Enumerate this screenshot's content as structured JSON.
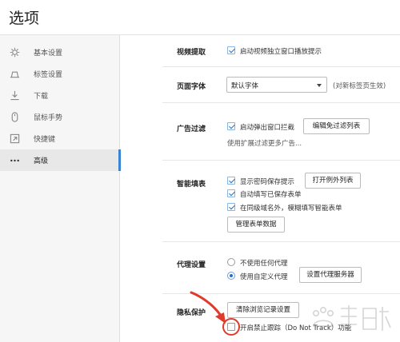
{
  "window": {
    "title": "选项"
  },
  "sidebar": {
    "items": [
      {
        "label": "基本设置",
        "icon": "gear-icon"
      },
      {
        "label": "标签设置",
        "icon": "tab-icon"
      },
      {
        "label": "下载",
        "icon": "download-icon"
      },
      {
        "label": "鼠标手势",
        "icon": "mouse-icon"
      },
      {
        "label": "快捷键",
        "icon": "shortcut-icon"
      },
      {
        "label": "高级",
        "icon": "more-icon",
        "active": true
      }
    ]
  },
  "video": {
    "label": "视频提取",
    "option": "启动视频独立窗口播放提示"
  },
  "font": {
    "label": "页面字体",
    "select_value": "默认字体",
    "note": "(对新标签页生效)"
  },
  "adfilter": {
    "label": "广告过滤",
    "option": "启动弹出窗口拦截",
    "button": "编辑免过滤列表",
    "note": "使用扩展过滤更多广告..."
  },
  "autofill": {
    "label": "智能填表",
    "options": [
      "显示密码保存提示",
      "自动填写已保存表单",
      "在同级域名外，模糊填写智能表单"
    ],
    "exception_button": "打开例外列表",
    "manage_button": "管理表单数据"
  },
  "proxy": {
    "label": "代理设置",
    "options": [
      "不使用任何代理",
      "使用自定义代理"
    ],
    "button": "设置代理服务器"
  },
  "privacy": {
    "label": "隐私保护",
    "button": "清除浏览记录设置",
    "dnt_option": "开启禁止跟踪（Do Not Track）功能"
  },
  "colors": {
    "accent": "#3a84d4",
    "annotation": "#e03a2a"
  }
}
